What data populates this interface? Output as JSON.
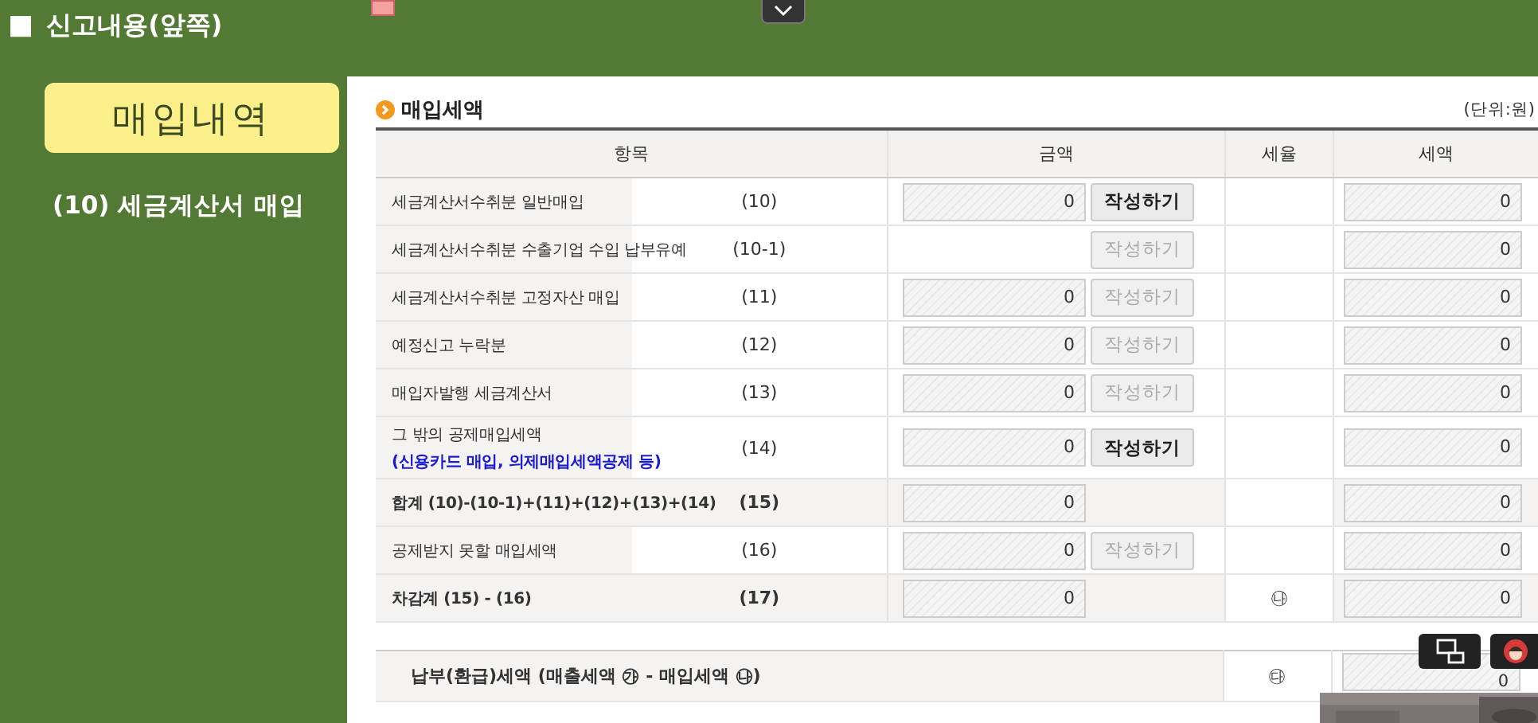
{
  "header": {
    "marker": "■",
    "title": "신고내용(앞쪽)"
  },
  "section_badge": "매입내역",
  "section_subtitle": "(10) 세금계산서 매입",
  "panel": {
    "title": "매입세액",
    "unit": "(단위:원)",
    "columns": [
      "항목",
      "금액",
      "세율",
      "세액"
    ],
    "rows": [
      {
        "label": "세금계산서수취분 일반매입",
        "code": "(10)",
        "total": false,
        "amount": "0",
        "button": {
          "label": "작성하기",
          "disabled": false
        },
        "tax": "0"
      },
      {
        "label": "세금계산서수취분 수출기업 수입 납부유예",
        "code": "(10-1)",
        "total": false,
        "button": {
          "label": "작성하기",
          "disabled": true
        },
        "tax": "0"
      },
      {
        "label": "세금계산서수취분 고정자산 매입",
        "code": "(11)",
        "total": false,
        "amount": "0",
        "button": {
          "label": "작성하기",
          "disabled": true
        },
        "tax": "0"
      },
      {
        "label": "예정신고 누락분",
        "code": "(12)",
        "total": false,
        "amount": "0",
        "button": {
          "label": "작성하기",
          "disabled": true
        },
        "tax": "0"
      },
      {
        "label": "매입자발행 세금계산서",
        "code": "(13)",
        "total": false,
        "amount": "0",
        "button": {
          "label": "작성하기",
          "disabled": true
        },
        "tax": "0"
      },
      {
        "label": "그 밖의 공제매입세액",
        "note": "(신용카드 매입, 의제매입세액공제 등)",
        "code": "(14)",
        "total": false,
        "amount": "0",
        "button": {
          "label": "작성하기",
          "disabled": false
        },
        "tax": "0"
      },
      {
        "label": "합계 (10)-(10-1)+(11)+(12)+(13)+(14)",
        "code": "(15)",
        "total": true,
        "amount": "0",
        "tax": "0"
      },
      {
        "label": "공제받지 못할 매입세액",
        "code": "(16)",
        "total": false,
        "amount": "0",
        "button": {
          "label": "작성하기",
          "disabled": true
        },
        "tax": "0"
      },
      {
        "label": "차감계 (15) - (16)",
        "code": "(17)",
        "total": true,
        "amount": "0",
        "rate": "㉯",
        "tax": "0"
      }
    ],
    "summary": {
      "label": "납부(환급)세액 (매출세액 ㉮ - 매입세액 ㉯)",
      "rate": "㉰",
      "tax": "0"
    }
  }
}
